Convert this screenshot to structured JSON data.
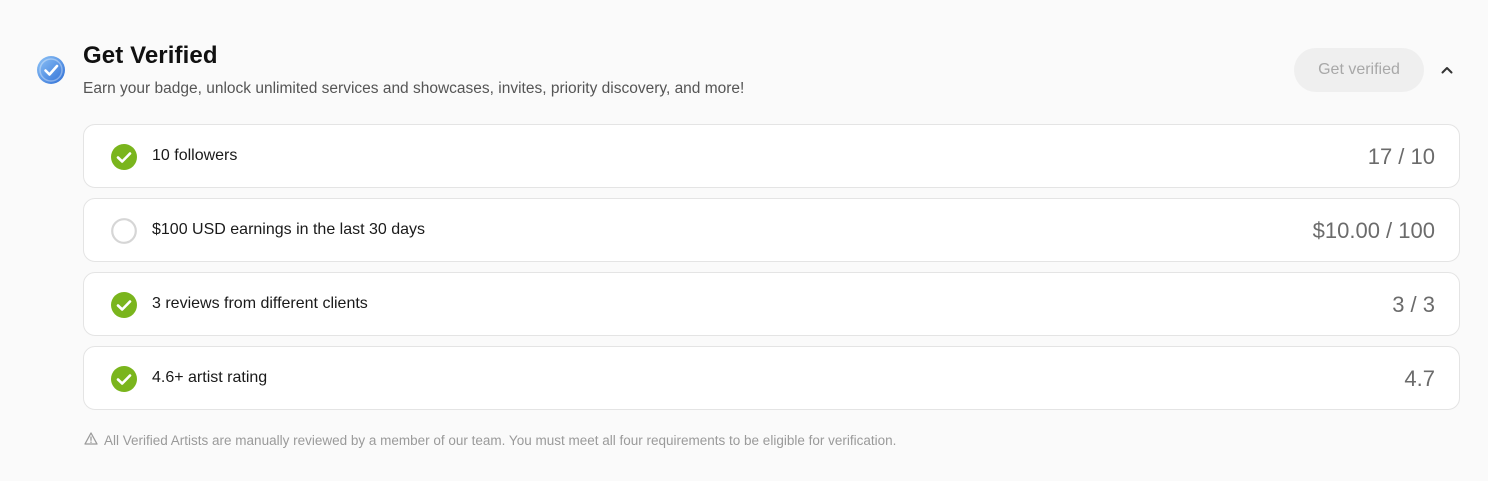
{
  "header": {
    "title": "Get Verified",
    "subtitle": "Earn your badge, unlock unlimited services and showcases, invites, priority discovery, and more!",
    "button_label": "Get verified",
    "badge_icon": "verified-check-icon",
    "toggle_icon": "chevron-up-icon"
  },
  "requirements": [
    {
      "label": "10 followers",
      "value": "17 / 10",
      "met": true
    },
    {
      "label": "$100 USD earnings in the last 30 days",
      "value": "$10.00 / 100",
      "met": false
    },
    {
      "label": "3 reviews from different clients",
      "value": "3 / 3",
      "met": true
    },
    {
      "label": "4.6+ artist rating",
      "value": "4.7",
      "met": true
    }
  ],
  "footnote": {
    "icon": "warning-icon",
    "text": "All Verified Artists are manually reviewed by a member of our team. You must meet all four requirements to be eligible for verification."
  },
  "colors": {
    "met": "#7ab51d",
    "unmet_border": "#d6d6d6",
    "badge_blue": "#4a90e2",
    "button_bg": "#efefef",
    "button_text": "#a8a8a8"
  }
}
